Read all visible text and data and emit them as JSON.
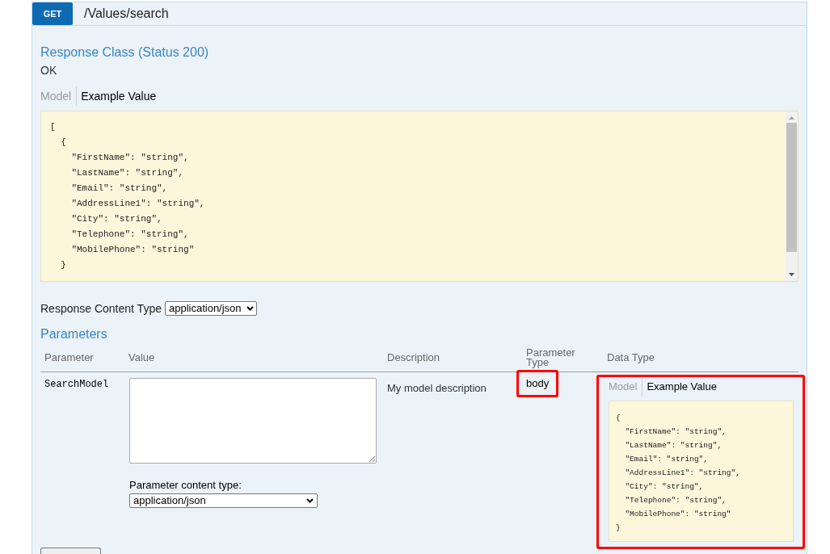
{
  "operation": {
    "method": "GET",
    "path": "/Values/search"
  },
  "response_class": {
    "heading": "Response Class (Status 200)",
    "status": "OK",
    "tabs": [
      {
        "label": "Model",
        "selected": false
      },
      {
        "label": "Example Value",
        "selected": true
      }
    ],
    "example_lines": [
      "[",
      "  {",
      "    \"FirstName\": \"string\",",
      "    \"LastName\": \"string\",",
      "    \"Email\": \"string\",",
      "    \"AddressLine1\": \"string\",",
      "    \"City\": \"string\",",
      "    \"Telephone\": \"string\",",
      "    \"MobilePhone\": \"string\"",
      "  }"
    ]
  },
  "response_content_type": {
    "label": "Response Content Type",
    "value": "application/json"
  },
  "parameters": {
    "heading": "Parameters",
    "columns": [
      "Parameter",
      "Value",
      "Description",
      "Parameter Type",
      "Data Type"
    ],
    "rows": [
      {
        "parameter": "SearchModel",
        "content_type_label": "Parameter content type:",
        "content_type": "application/json",
        "description": "My model description",
        "parameter_type": {
          "text": "body",
          "highlighted": true
        },
        "data_type": {
          "highlighted": true,
          "tabs": [
            {
              "label": "Model",
              "selected": false
            },
            {
              "label": "Example Value",
              "selected": true
            }
          ],
          "example_lines": [
            "{",
            "  \"FirstName\": \"string\",",
            "  \"LastName\": \"string\",",
            "  \"Email\": \"string\",",
            "  \"AddressLine1\": \"string\",",
            "  \"City\": \"string\",",
            "  \"Telephone\": \"string\",",
            "  \"MobilePhone\": \"string\"",
            "}"
          ]
        }
      }
    ]
  }
}
